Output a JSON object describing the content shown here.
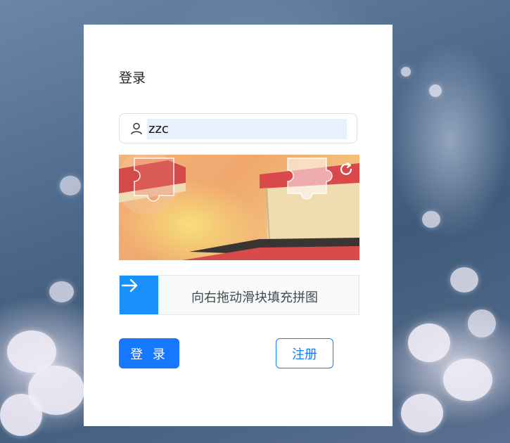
{
  "form": {
    "title": "登录",
    "username": {
      "value": "zzc",
      "icon": "user-icon"
    },
    "captcha": {
      "slider_text": "向右拖动滑块填充拼图",
      "refresh_icon": "refresh-icon",
      "handle_icon": "arrow-right-icon"
    },
    "login_label": "登 录",
    "register_label": "注册"
  },
  "colors": {
    "primary": "#1677ff",
    "slider_handle": "#1991fa"
  }
}
